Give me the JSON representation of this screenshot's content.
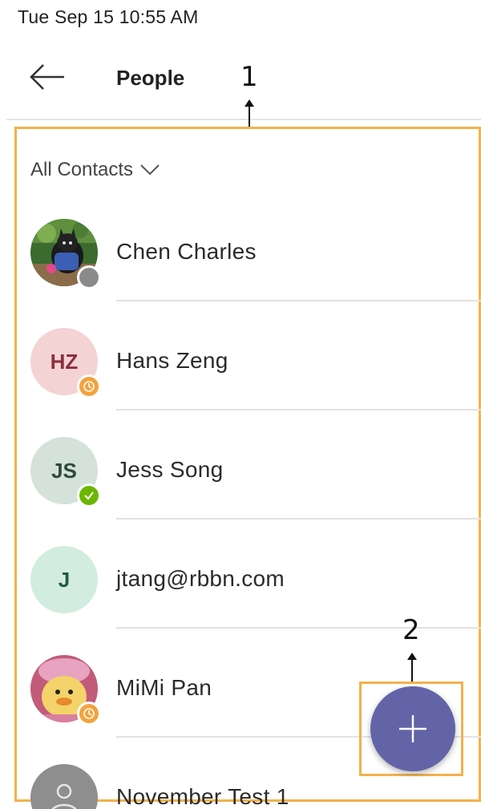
{
  "status_bar": {
    "datetime": "Tue Sep 15  10:55 AM"
  },
  "header": {
    "title": "People",
    "back_icon": "arrow-left-icon"
  },
  "annotations": {
    "callout_1": "1",
    "callout_2": "2",
    "highlight_color": "#f2b24c"
  },
  "filter": {
    "label": "All Contacts",
    "icon": "chevron-down-icon"
  },
  "contacts": [
    {
      "name": "Chen Charles",
      "initials": "",
      "avatar_type": "photo-cat",
      "presence": "offline"
    },
    {
      "name": "Hans Zeng",
      "initials": "HZ",
      "avatar_type": "initials",
      "avatar_bg": "#f4d3d5",
      "avatar_fg": "#8b2f3c",
      "presence": "away"
    },
    {
      "name": "Jess Song",
      "initials": "JS",
      "avatar_type": "initials",
      "avatar_bg": "#d4e2da",
      "avatar_fg": "#2e4a3a",
      "presence": "available"
    },
    {
      "name": "jtang@rbbn.com",
      "initials": "J",
      "avatar_type": "initials",
      "avatar_bg": "#d3ece0",
      "avatar_fg": "#1f5b3f",
      "presence": "none"
    },
    {
      "name": "MiMi Pan",
      "initials": "",
      "avatar_type": "photo-duck",
      "presence": "away"
    },
    {
      "name": "November Test 1",
      "initials": "",
      "avatar_type": "generic",
      "presence": "none"
    }
  ],
  "fab": {
    "icon": "plus-icon",
    "color": "#6264a7"
  },
  "colors": {
    "away": "#f4a23c",
    "available": "#6bb700",
    "offline": "#8a8a8a"
  }
}
